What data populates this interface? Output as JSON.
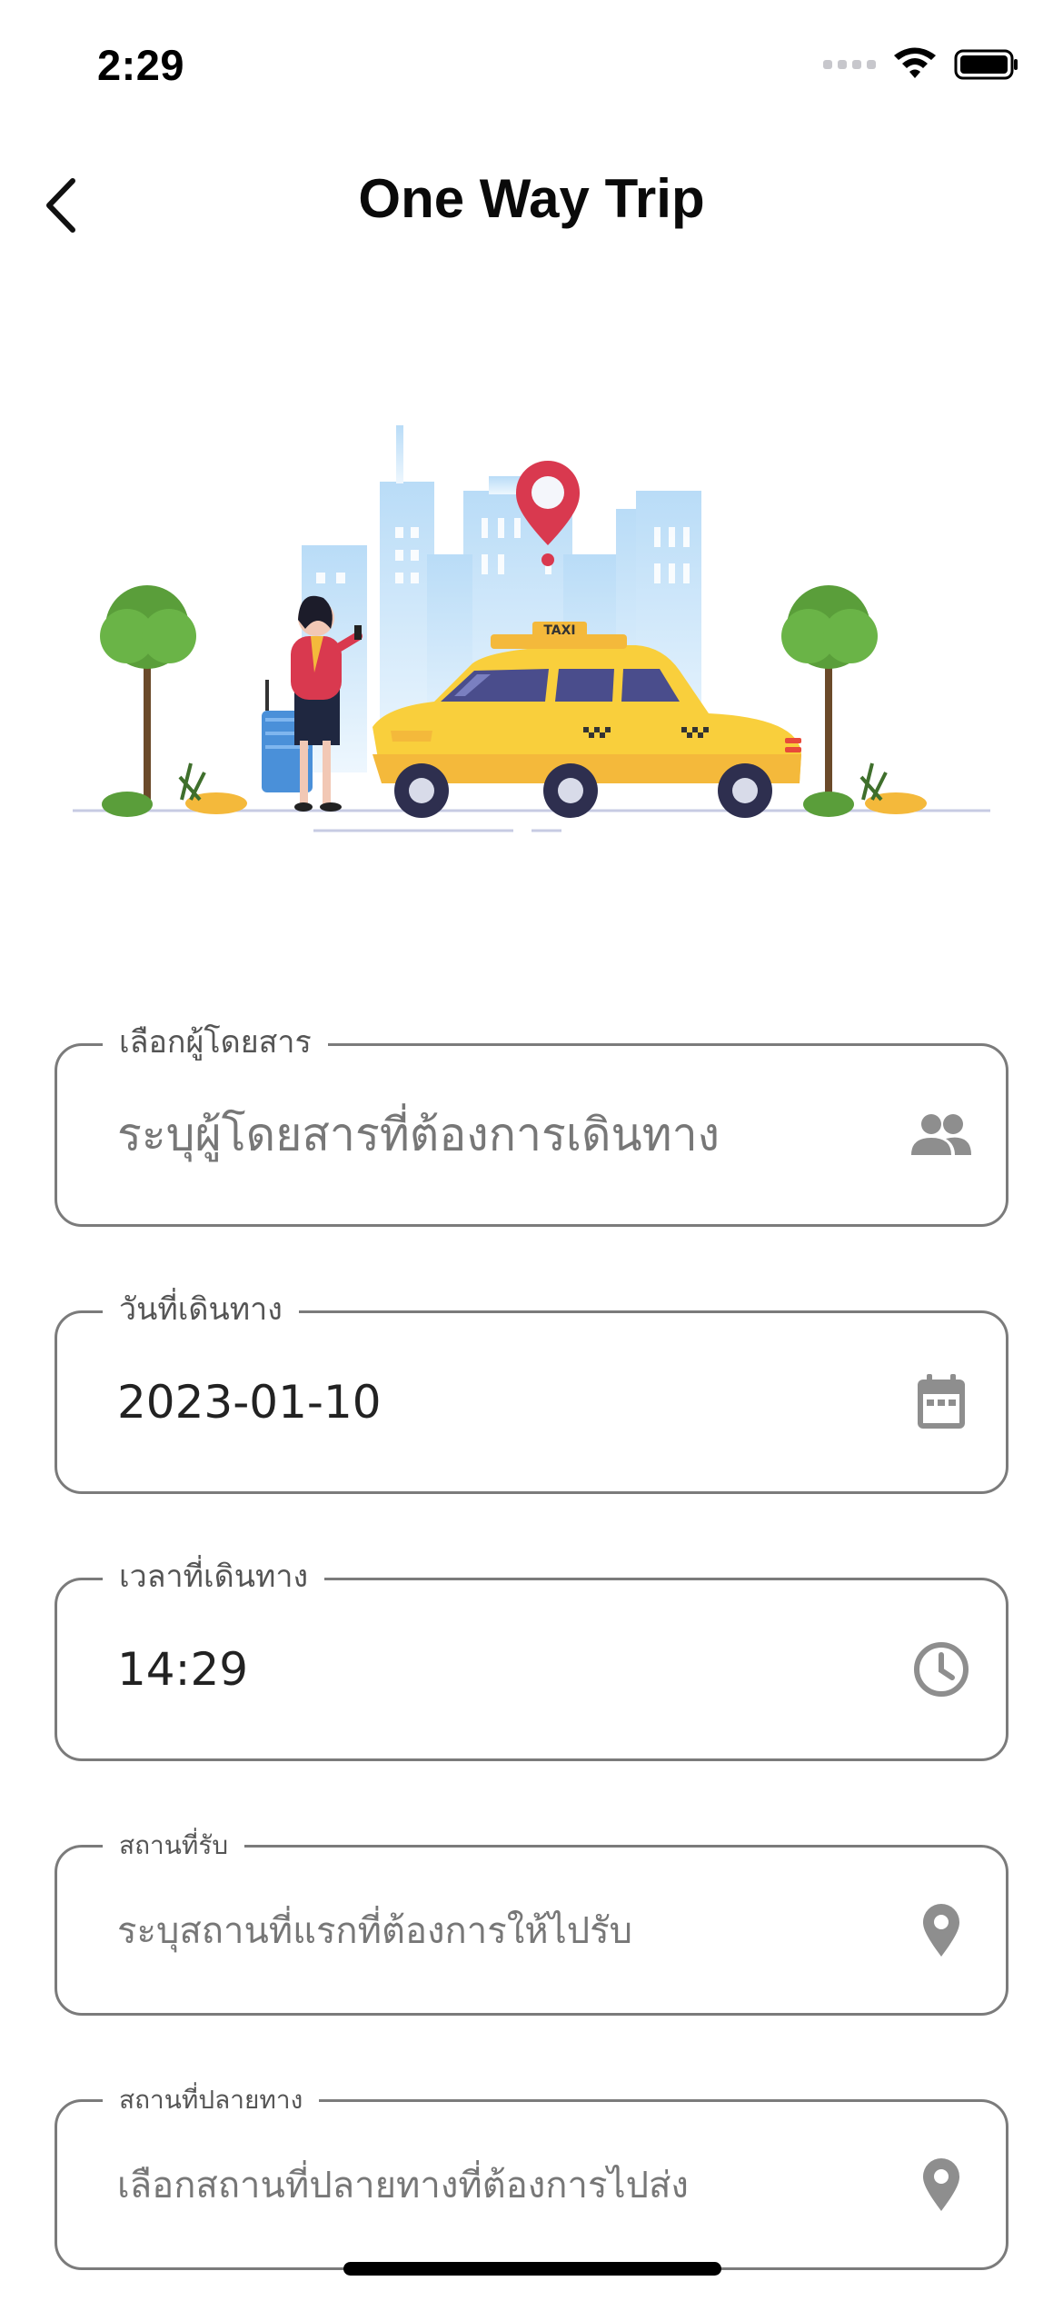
{
  "status_bar": {
    "time": "2:29"
  },
  "header": {
    "title": "One Way Trip"
  },
  "illustration": {
    "taxi_sign": "TAXI"
  },
  "form": {
    "passenger": {
      "label": "เลือกผู้โดยสาร",
      "placeholder": "ระบุผู้โดยสารที่ต้องการเดินทาง",
      "icon": "people-icon"
    },
    "date": {
      "label": "วันที่เดินทาง",
      "value": "2023-01-10",
      "icon": "calendar-icon"
    },
    "time": {
      "label": "เวลาที่เดินทาง",
      "value": "14:29",
      "icon": "clock-icon"
    },
    "pickup": {
      "label": "สถานที่รับ",
      "placeholder": "ระบุสถานที่แรกที่ต้องการให้ไปรับ",
      "icon": "location-pin-icon"
    },
    "destination": {
      "label": "สถานที่ปลายทาง",
      "placeholder": "เลือกสถานที่ปลายทางที่ต้องการไปส่ง",
      "icon": "location-pin-icon"
    }
  },
  "colors": {
    "icon_gray": "#8e8e8e",
    "border_gray": "#7b7b7b",
    "taxi_yellow": "#f9cf3c",
    "pin_red": "#d9394f"
  }
}
